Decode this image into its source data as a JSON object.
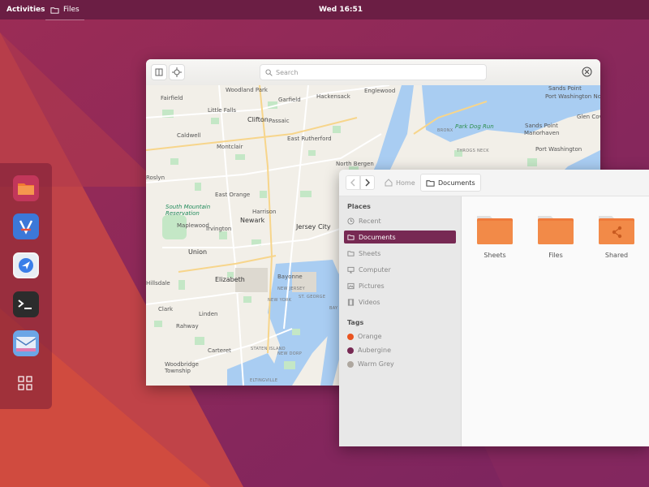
{
  "topbar": {
    "activities": "Activities",
    "app_name": "Files",
    "clock": "Wed 16:51"
  },
  "dock": {
    "items": [
      {
        "name": "files",
        "icon": "folder-app-icon"
      },
      {
        "name": "app-center",
        "icon": "app-store-icon"
      },
      {
        "name": "maps",
        "icon": "navigation-icon"
      },
      {
        "name": "terminal",
        "icon": "terminal-icon"
      },
      {
        "name": "mail",
        "icon": "mail-icon"
      }
    ],
    "show_apps_icon": "grid-icon"
  },
  "maps": {
    "search_placeholder": "Search",
    "places": {
      "woodland_park": "Woodland Park",
      "fairfield": "Fairfield",
      "little_falls": "Little Falls",
      "garfield": "Garfield",
      "hackensack": "Hackensack",
      "englewood": "Englewood",
      "sands_point": "Sands Point",
      "port_washington_north": "Port Washington North",
      "clifton": "Clifton",
      "passaic": "Passaic",
      "caldwell": "Caldwell",
      "east_rutherford": "East Rutherford",
      "bronx": "BRONX",
      "park_dog_run": "Park Dog Run",
      "sands_point2": "Sands Point",
      "manorhaven": "Manorhaven",
      "glen_cove": "Glen Cove",
      "port_washington": "Port Washington",
      "montclair": "Montclair",
      "north_bergen": "North Bergen",
      "throgs_neck": "THROGS NECK",
      "east_orange": "East Orange",
      "harrison": "Harrison",
      "south_mountain_reservation": "South Mountain Reservation",
      "newark": "Newark",
      "jersey_city": "Jersey City",
      "maplewood": "Maplewood",
      "irvington": "Irvington",
      "union": "Union",
      "elizabeth": "Elizabeth",
      "bayonne": "Bayonne",
      "new_jersey": "NEW JERSEY",
      "new_york": "NEW YORK",
      "st_george": "ST. GEORGE",
      "clark": "Clark",
      "linden": "Linden",
      "rahway": "Rahway",
      "carteret": "Carteret",
      "staten_island": "STATEN ISLAND",
      "new_dorp": "NEW DORP",
      "woodbridge_township": "Woodbridge Township",
      "eltingville": "ELTINGVILLE",
      "roslyn": "Roslyn",
      "hillsdale": "Hillsdale",
      "bay_ridge": "BAY"
    }
  },
  "files": {
    "breadcrumb": {
      "home": "Home",
      "current": "Documents"
    },
    "sidebar": {
      "places_header": "Places",
      "items": [
        {
          "label": "Recent",
          "icon": "clock-icon"
        },
        {
          "label": "Documents",
          "icon": "folder-icon",
          "active": true
        },
        {
          "label": "Sheets",
          "icon": "folder-icon"
        },
        {
          "label": "Computer",
          "icon": "monitor-icon"
        },
        {
          "label": "Pictures",
          "icon": "image-icon"
        },
        {
          "label": "Videos",
          "icon": "film-icon"
        }
      ],
      "tags_header": "Tags",
      "tags": [
        {
          "label": "Orange",
          "color": "#e95420"
        },
        {
          "label": "Aubergine",
          "color": "#772953"
        },
        {
          "label": "Warm Grey",
          "color": "#aea79f"
        }
      ]
    },
    "folders": [
      {
        "label": "Sheets"
      },
      {
        "label": "Files"
      },
      {
        "label": "Shared"
      }
    ]
  },
  "colors": {
    "accent": "#772953",
    "orange": "#e95420",
    "topbar": "#6b1e44"
  }
}
